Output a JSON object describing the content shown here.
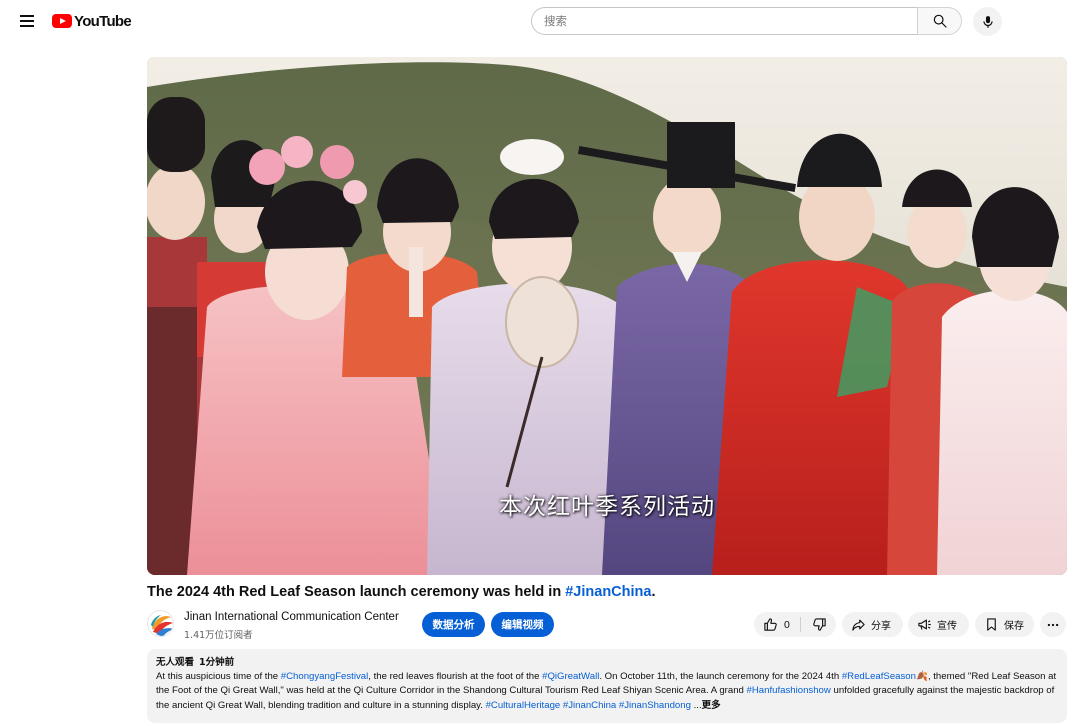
{
  "header": {
    "logo_text": "YouTube",
    "search_placeholder": "搜索"
  },
  "video": {
    "subtitle": "本次红叶季系列活动"
  },
  "title": {
    "text": "The 2024 4th Red Leaf Season launch ceremony was held in ",
    "link": "#JinanChina",
    "end": "."
  },
  "channel": {
    "name": "Jinan International Communication Center",
    "subscribers": "1.41万位订阅者"
  },
  "actions": {
    "analytics_label": "数据分析",
    "edit_label": "编辑视频",
    "like_count": "0",
    "share_label": "分享",
    "promote_label": "宣传",
    "save_label": "保存"
  },
  "description": {
    "views": "无人观看",
    "time": "1分钟前",
    "p1": "At this auspicious time of the ",
    "tag1": "#ChongyangFestival",
    "p2": ", the red leaves flourish at the foot of the ",
    "tag2": "#QiGreatWall",
    "p3": ". On October 11th, the launch ceremony for the 2024 4th ",
    "tag3": "#RedLeafSeason",
    "emoji": "🍂",
    "p4": ", themed \"Red Leaf Season at the Foot of the Qi Great Wall,\" was held at the Qi Culture Corridor in the Shandong Cultural Tourism Red Leaf Shiyan Scenic Area. A grand ",
    "tag4": "#Hanfufashionshow",
    "p5": " unfolded gracefully against the majestic backdrop of the ancient Qi Great Wall, blending tradition and culture in a stunning display.  ",
    "tag5": "#CulturalHeritage",
    "tag6": "#JinanChina",
    "tag7": "#JinanShandong",
    "ellipsis": " ...",
    "more_label": "更多"
  },
  "colors": {
    "brand_red": "#ff0000",
    "link_blue": "#065fd4",
    "button_blue": "#065fd4",
    "chip_gray": "#f2f2f2"
  },
  "icons": [
    "menu-icon",
    "youtube-logo-icon",
    "search-icon",
    "microphone-icon",
    "thumbs-up-icon",
    "thumbs-down-icon",
    "share-icon",
    "promote-icon",
    "save-icon",
    "more-icon"
  ]
}
